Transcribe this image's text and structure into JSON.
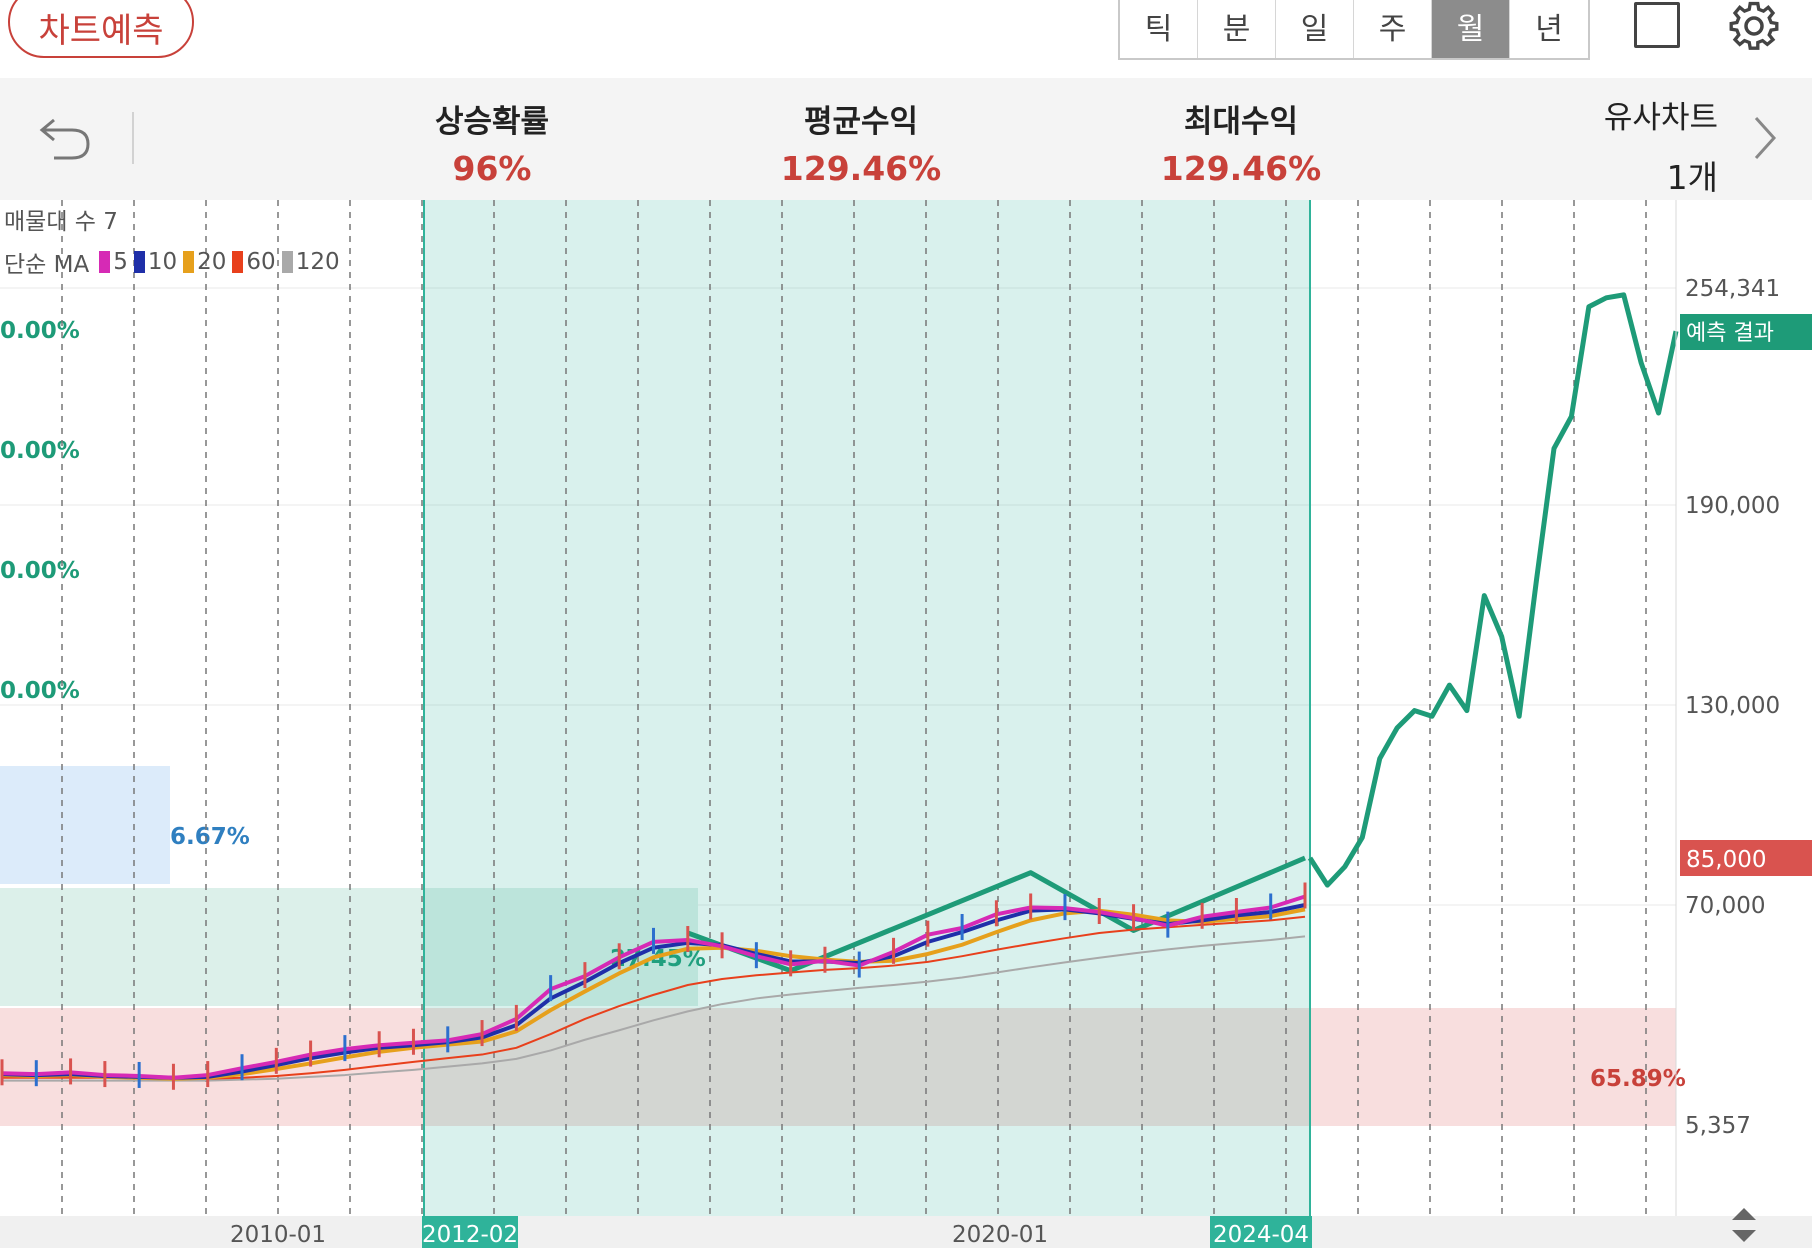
{
  "header": {
    "predict_button": "차트예측",
    "periods": [
      "틱",
      "분",
      "일",
      "주",
      "월",
      "년"
    ],
    "active_period": "월"
  },
  "stats": {
    "rise_prob_label": "상승확률",
    "rise_prob_value": "96%",
    "avg_return_label": "평균수익",
    "avg_return_value": "129.46%",
    "max_return_label": "최대수익",
    "max_return_value": "129.46%",
    "similar_label": "유사차트",
    "similar_count": "1개"
  },
  "legend": {
    "volume_profile": "매물대 수 7",
    "ma_title": "단순 MA",
    "ma_periods": [
      "5",
      "10",
      "20",
      "60",
      "120"
    ]
  },
  "colors": {
    "prediction": "#1e9b78",
    "highlight": "#2fb39a",
    "price_tag": "#d9534f",
    "up": "#d9534f",
    "down": "#2c6fce",
    "ma5": "#d62ab5",
    "ma10": "#1f2fa8",
    "ma20": "#e6a01c",
    "ma60": "#e8401c",
    "ma120": "#a9a9a9"
  },
  "icons": {
    "back": "undo-arrow-icon",
    "fullscreen": "square-icon",
    "settings": "gear-icon",
    "next": "chevron-right-icon",
    "scroll": "up-down-arrows-icon"
  },
  "chart_data": {
    "type": "line",
    "scale": "log",
    "x_ticks": [
      "2010-01",
      "2020-01"
    ],
    "highlight_start_label": "2012-02",
    "highlight_end_label": "2024-04",
    "y_ticks": [
      {
        "value": 254341,
        "label": "254,341"
      },
      {
        "value": 190000,
        "label": "190,000"
      },
      {
        "value": 130000,
        "label": "130,000"
      },
      {
        "value": 70000,
        "label": "70,000"
      },
      {
        "value": 5357,
        "label": "5,357"
      }
    ],
    "current_price": {
      "value": 85000,
      "label": "85,000"
    },
    "prediction_label": "예측 결과",
    "volume_profile": [
      {
        "pct": "0.00%",
        "color": "#1e9b78"
      },
      {
        "pct": "0.00%",
        "color": "#1e9b78"
      },
      {
        "pct": "0.00%",
        "color": "#1e9b78"
      },
      {
        "pct": "0.00%",
        "color": "#1e9b78"
      },
      {
        "pct": "6.67%",
        "color": "#2f7fc0"
      },
      {
        "pct": "27.45%",
        "color": "#1e9b78"
      },
      {
        "pct": "65.89%",
        "color": "#c8413a"
      }
    ],
    "series": [
      {
        "name": "5",
        "color": "#d62ab5",
        "values": [
          9800,
          9700,
          9900,
          9600,
          9500,
          9300,
          9600,
          10400,
          11200,
          12200,
          13000,
          13600,
          14000,
          14400,
          15500,
          18500,
          26200,
          30500,
          38000,
          45500,
          46500,
          43200,
          38500,
          35000,
          36500,
          34500,
          40500,
          49500,
          53500,
          62800,
          68000,
          67500,
          64500,
          60000,
          55000,
          61000,
          64500,
          68000,
          72500
        ]
      },
      {
        "name": "10",
        "color": "#1f2fa8",
        "values": [
          9700,
          9600,
          9700,
          9500,
          9400,
          9300,
          9400,
          10000,
          10800,
          11700,
          12500,
          13200,
          13600,
          14100,
          14900,
          17200,
          23500,
          28500,
          35500,
          42500,
          45000,
          43800,
          39500,
          36200,
          36200,
          35500,
          38500,
          45500,
          51000,
          58500,
          65500,
          66500,
          63500,
          59500,
          56000,
          58500,
          62000,
          64500,
          70000
        ]
      },
      {
        "name": "20",
        "color": "#e6a01c",
        "values": [
          9600,
          9500,
          9600,
          9400,
          9300,
          9200,
          9300,
          9700,
          10300,
          11000,
          11800,
          12600,
          13200,
          13700,
          14200,
          16000,
          20500,
          25500,
          31500,
          38000,
          42000,
          42500,
          41000,
          38500,
          37000,
          36000,
          36500,
          39500,
          44000,
          51000,
          58500,
          63500,
          65500,
          62500,
          58500,
          57500,
          59500,
          61500,
          66500
        ]
      },
      {
        "name": "60",
        "color": "#e8401c",
        "values": [
          9300,
          9300,
          9300,
          9300,
          9300,
          9200,
          9200,
          9300,
          9500,
          9800,
          10200,
          10700,
          11200,
          11700,
          12200,
          13200,
          15500,
          18500,
          21500,
          24500,
          27500,
          29500,
          30800,
          31800,
          32800,
          33500,
          34500,
          36000,
          38500,
          41500,
          44500,
          47500,
          50500,
          52500,
          54000,
          55500,
          57000,
          58500,
          61000
        ]
      },
      {
        "name": "120",
        "color": "#a9a9a9",
        "values": [
          9000,
          9000,
          9000,
          9000,
          9000,
          9000,
          9000,
          9100,
          9200,
          9400,
          9600,
          9900,
          10200,
          10600,
          11000,
          11600,
          12800,
          14500,
          16200,
          18200,
          20200,
          22000,
          23500,
          24600,
          25600,
          26600,
          27500,
          28600,
          30000,
          31800,
          33800,
          35800,
          37800,
          39800,
          41700,
          43400,
          45000,
          46500,
          48500
        ]
      },
      {
        "name": "pattern",
        "color": "#1e9b78",
        "values": [
          null,
          null,
          null,
          null,
          null,
          null,
          null,
          null,
          null,
          null,
          null,
          null,
          null,
          null,
          null,
          null,
          null,
          null,
          null,
          null,
          50500,
          null,
          null,
          32500,
          null,
          null,
          null,
          null,
          null,
          null,
          80000,
          null,
          null,
          52000,
          null,
          null,
          null,
          null,
          85000
        ]
      },
      {
        "name": "prediction",
        "color": "#1e9b78",
        "values": [
          85000,
          76000,
          82000,
          90000,
          112000,
          122000,
          128000,
          126000,
          135000,
          128000,
          160000,
          148000,
          126000,
          165000,
          205000,
          214000,
          248000,
          251000,
          252000,
          230000,
          215000,
          240000
        ]
      }
    ]
  }
}
